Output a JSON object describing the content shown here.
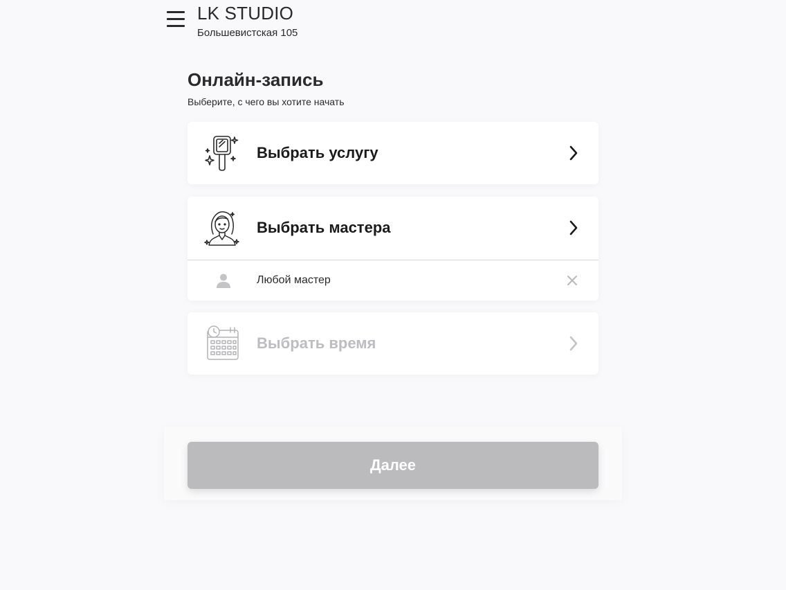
{
  "header": {
    "title": "LK STUDIO",
    "address": "Большевистская 105"
  },
  "intro": {
    "title": "Онлайн-запись",
    "subtitle": "Выберите, с чего вы хотите начать"
  },
  "options": {
    "service": {
      "label": "Выбрать услугу",
      "icon": "hand-mirror-icon"
    },
    "master": {
      "label": "Выбрать мастера",
      "icon": "stylist-icon",
      "selected": {
        "label": "Любой мастер",
        "icon": "person-icon",
        "clear_icon": "close-icon"
      }
    },
    "time": {
      "label": "Выбрать время",
      "icon": "calendar-clock-icon",
      "disabled": true
    }
  },
  "footer": {
    "next_label": "Далее",
    "next_disabled": true
  },
  "colors": {
    "background": "#f9f8fa",
    "card": "#ffffff",
    "text": "#1a1a1a",
    "disabled_text": "#bdbcc0",
    "button_disabled": "#bbbabd"
  }
}
